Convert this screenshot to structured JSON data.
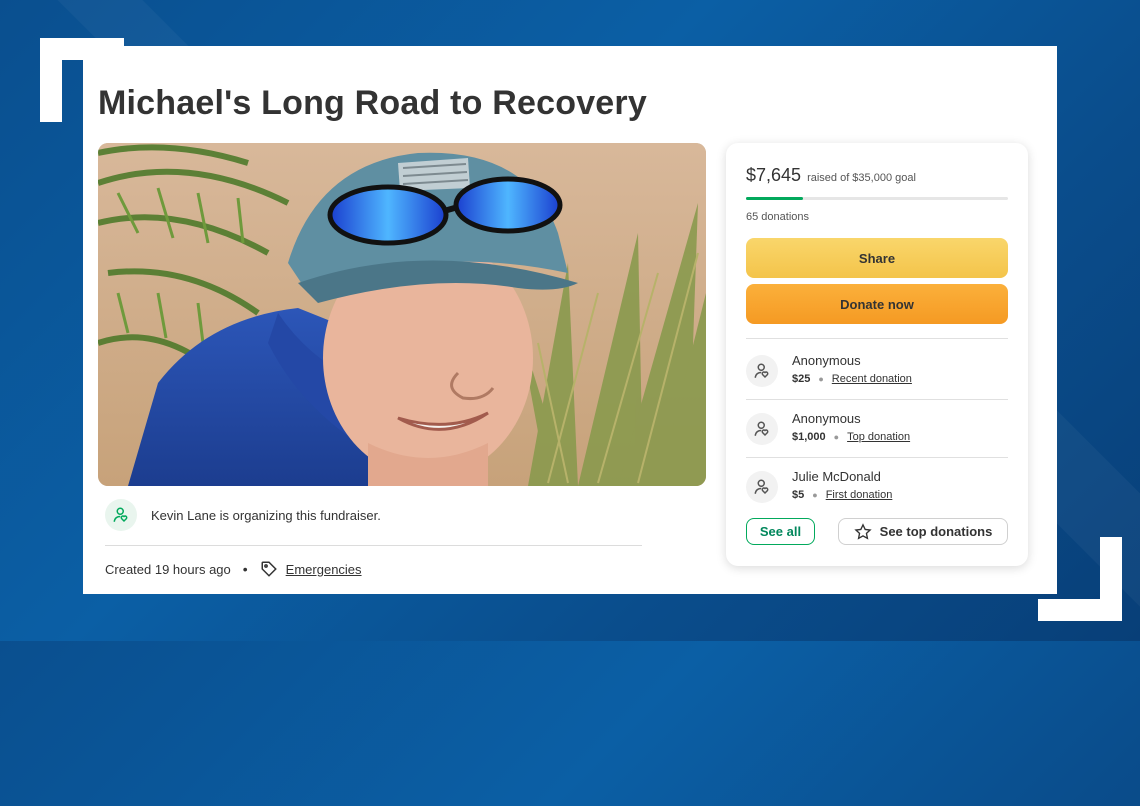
{
  "campaign": {
    "title": "Michael's Long Road to Recovery",
    "organizer_text": "Kevin Lane is organizing this fundraiser.",
    "created": "Created 19 hours ago",
    "category": "Emergencies"
  },
  "sidebar": {
    "raised_amount": "$7,645",
    "raised_goal_text": "raised of $35,000 goal",
    "progress_fraction": 0.218,
    "donation_count": "65 donations",
    "share_label": "Share",
    "donate_label": "Donate now",
    "donations": [
      {
        "name": "Anonymous",
        "amount": "$25",
        "type": "Recent donation"
      },
      {
        "name": "Anonymous",
        "amount": "$1,000",
        "type": "Top donation"
      },
      {
        "name": "Julie McDonald",
        "amount": "$5",
        "type": "First donation"
      }
    ],
    "see_all_label": "See all",
    "see_top_label": "See top donations"
  },
  "colors": {
    "brand_green": "#02a95c",
    "share_yellow": "#f4c44a",
    "donate_orange": "#f59a23",
    "background_blue": "#0b5fa5"
  },
  "icons": {
    "organizer": "user-heart-icon",
    "category": "tag-icon",
    "donor": "user-heart-icon",
    "top_donations": "star-icon"
  }
}
